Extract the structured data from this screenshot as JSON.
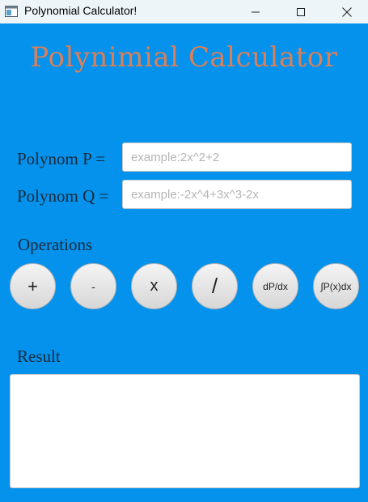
{
  "window": {
    "title": "Polynomial Calculator!",
    "icon": "app-window-icon"
  },
  "app": {
    "heading": "Polynimial Calculator",
    "heading_color": "#d9805a",
    "background_color": "#0492ec"
  },
  "inputs": {
    "p_label": "Polynom P =",
    "p_placeholder": "example:2x^2+2",
    "p_value": "",
    "q_label": "Polynom Q =",
    "q_placeholder": "example:-2x^4+3x^3-2x",
    "q_value": ""
  },
  "operations": {
    "label": "Operations",
    "buttons": [
      {
        "name": "add",
        "label": "+"
      },
      {
        "name": "subtract",
        "label": "-"
      },
      {
        "name": "multiply",
        "label": "x"
      },
      {
        "name": "divide",
        "label": "/"
      },
      {
        "name": "derivative",
        "label": "dP/dx"
      },
      {
        "name": "integral",
        "label": "∫P(x)dx"
      }
    ]
  },
  "result": {
    "label": "Result",
    "value": ""
  }
}
